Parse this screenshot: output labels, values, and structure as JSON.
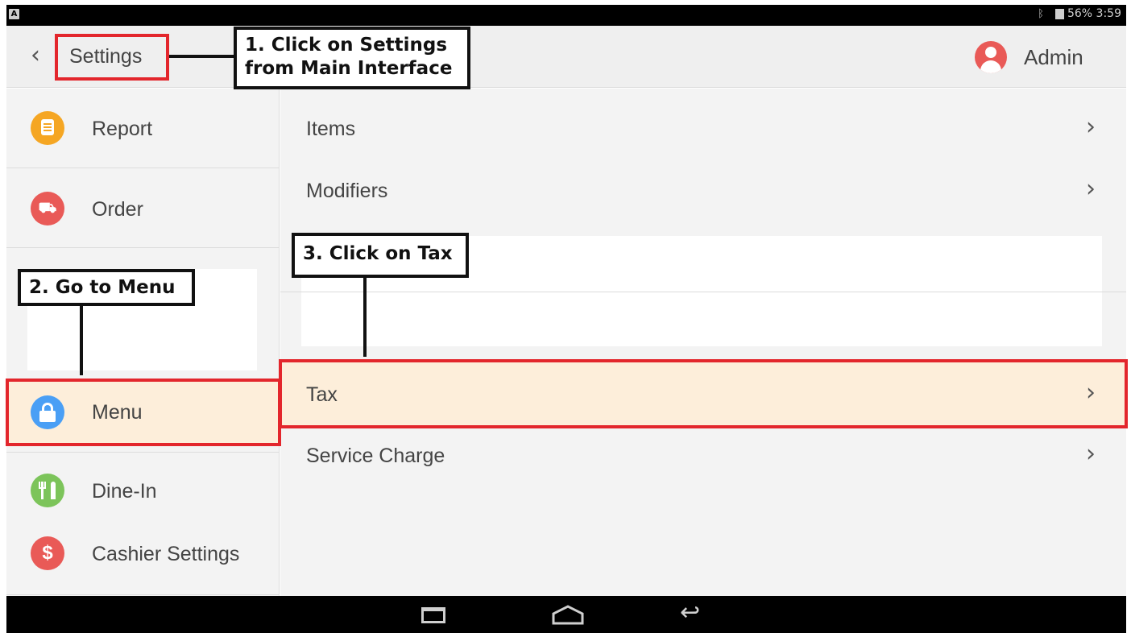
{
  "status_bar": {
    "left_badge": "A",
    "right_text": "56% 3:59"
  },
  "app_bar": {
    "back_glyph": "‹",
    "title": "Settings",
    "user_label": "Admin"
  },
  "sidebar": {
    "items": [
      {
        "label": "Report",
        "icon": "report-icon",
        "icon_glyph": "≡",
        "color": "#f5a623"
      },
      {
        "label": "Order",
        "icon": "delivery-truck-icon",
        "icon_glyph": "⛟",
        "color": "#e95a57"
      },
      {
        "label": "Menu",
        "icon": "lock-icon",
        "icon_glyph": "🔒",
        "color": "#4a9ff5",
        "selected": true
      },
      {
        "label": "Dine-In",
        "icon": "fork-knife-icon",
        "icon_glyph": "🍴",
        "color": "#7cc45a"
      },
      {
        "label": "Cashier Settings",
        "icon": "dollar-icon",
        "icon_glyph": "$",
        "color": "#e95a57"
      }
    ]
  },
  "main": {
    "rows": [
      {
        "label": "Items",
        "chevron": "›"
      },
      {
        "label": "Modifiers",
        "chevron": "›"
      },
      {
        "label": "Tax",
        "chevron": "›",
        "selected": true
      },
      {
        "label": "Service Charge",
        "chevron": "›"
      }
    ]
  },
  "annotations": {
    "step1_line1": "1. Click on Settings",
    "step1_line2": "from Main Interface",
    "step2": "2. Go to Menu",
    "step3": "3. Click on Tax"
  },
  "nav_bar": {
    "back_glyph": "↩"
  },
  "colors": {
    "highlight_red": "#e3262c",
    "selected_bg": "#fdeeda",
    "panel_bg": "#f3f3f3"
  }
}
